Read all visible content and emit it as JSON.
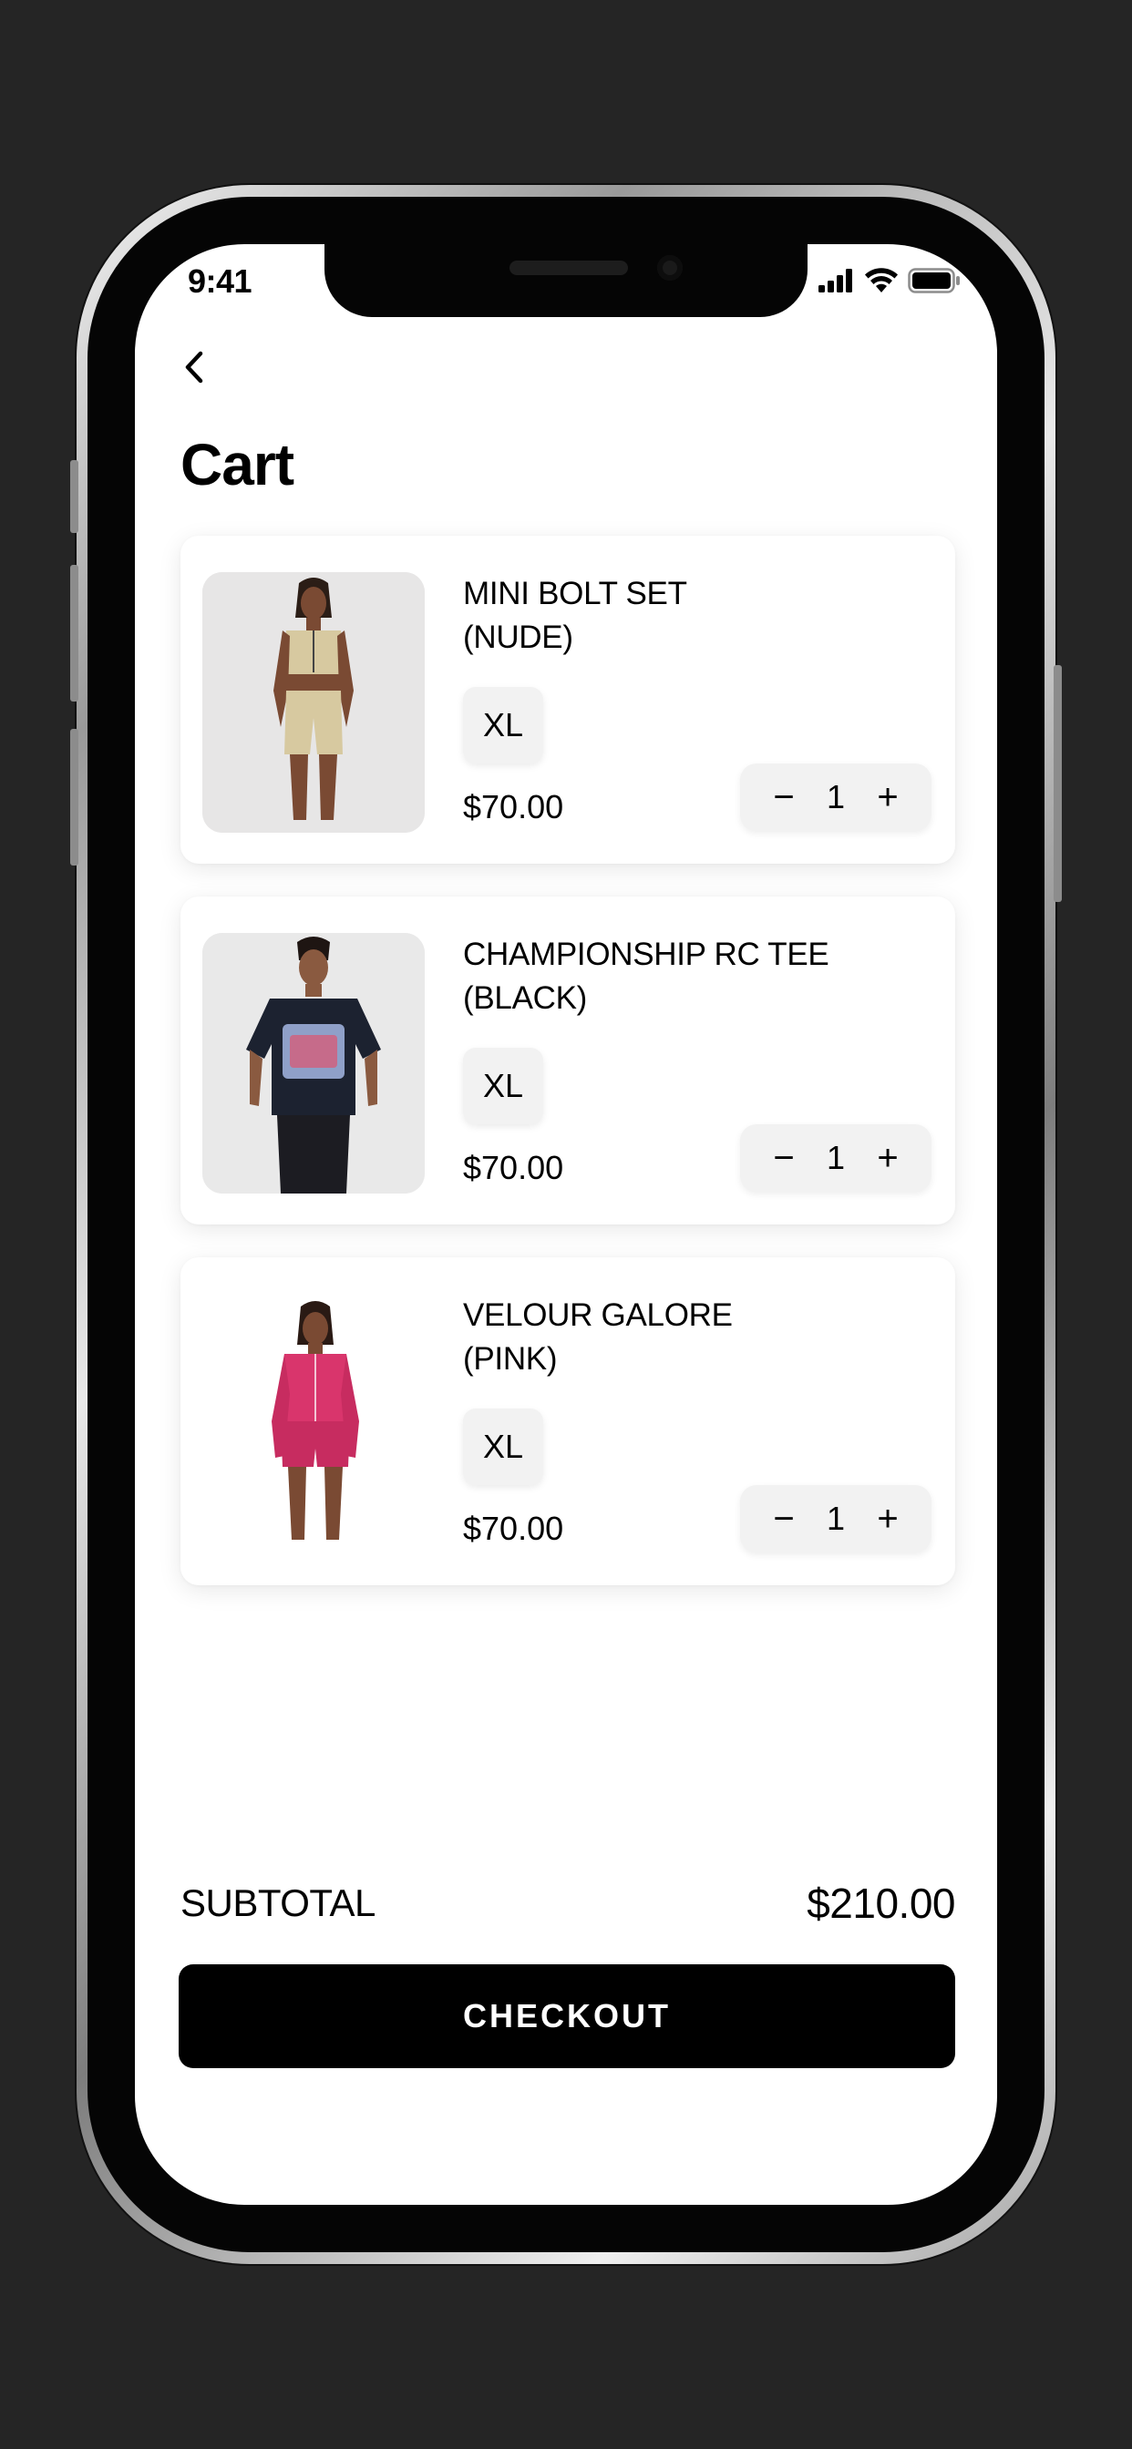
{
  "status_bar": {
    "time": "9:41"
  },
  "page": {
    "title": "Cart"
  },
  "cart_items": [
    {
      "name_line1": "MINI BOLT SET",
      "name_line2": "(NUDE)",
      "size": "XL",
      "price": "$70.00",
      "quantity": "1",
      "image_desc": "model in nude two-piece set"
    },
    {
      "name_line1": "CHAMPIONSHIP RC TEE",
      "name_line2": "(BLACK)",
      "size": "XL",
      "price": "$70.00",
      "quantity": "1",
      "image_desc": "model in black graphic tee"
    },
    {
      "name_line1": "VELOUR GALORE",
      "name_line2": "(PINK)",
      "size": "XL",
      "price": "$70.00",
      "quantity": "1",
      "image_desc": "model in pink velour set"
    }
  ],
  "stepper": {
    "minus": "−",
    "plus": "+"
  },
  "summary": {
    "subtotal_label": "SUBTOTAL",
    "subtotal_value": "$210.00"
  },
  "checkout": {
    "label": "CHECKOUT"
  },
  "colors": {
    "accent": "#000000",
    "background": "#252525",
    "card": "#ffffff",
    "chip": "#f2f2f2"
  }
}
